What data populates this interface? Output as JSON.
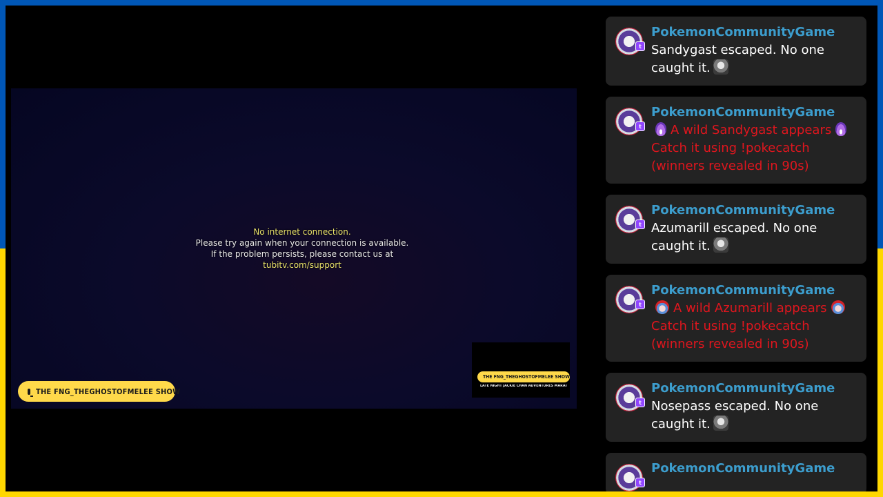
{
  "player": {
    "error_lines": [
      "No internet connection.",
      "Please try again when your connection is available.",
      "If the problem persists, please contact us at",
      "tubitv.com/support"
    ],
    "show_badge": "THE FNG_THEGHOSTOFMELEE SHOW",
    "mini_badge": "THE FNG_THEGHOSTOFMELEE SHOW",
    "mini_subtitle": "LATE NIGHT JACKIE CHAN ADVENTURES MARATHON"
  },
  "chat": {
    "messages": [
      {
        "user": "PokemonCommunityGame",
        "text": "Sandygast escaped. No one caught it.",
        "emote": "noped-emote",
        "style": "normal"
      },
      {
        "user": "PokemonCommunityGame",
        "text": "A wild Sandygast appears",
        "text2": "Catch it using !pokecatch (winners revealed in 90s)",
        "emote": "flame-icon",
        "style": "alert"
      },
      {
        "user": "PokemonCommunityGame",
        "text": "Azumarill escaped. No one caught it.",
        "emote": "noped-emote",
        "style": "normal"
      },
      {
        "user": "PokemonCommunityGame",
        "text": "A wild Azumarill appears",
        "text2": "Catch it using !pokecatch (winners revealed in 90s)",
        "emote": "santa-icon",
        "style": "alert"
      },
      {
        "user": "PokemonCommunityGame",
        "text": "Nosepass escaped. No one caught it.",
        "emote": "noped-emote",
        "style": "normal"
      },
      {
        "user": "PokemonCommunityGame"
      }
    ]
  },
  "colors": {
    "username": "#3c9dcd",
    "alert_text": "#e0161e",
    "badge": "#ffd94a",
    "flag_top": "#0057b7",
    "flag_bottom": "#ffd700"
  }
}
